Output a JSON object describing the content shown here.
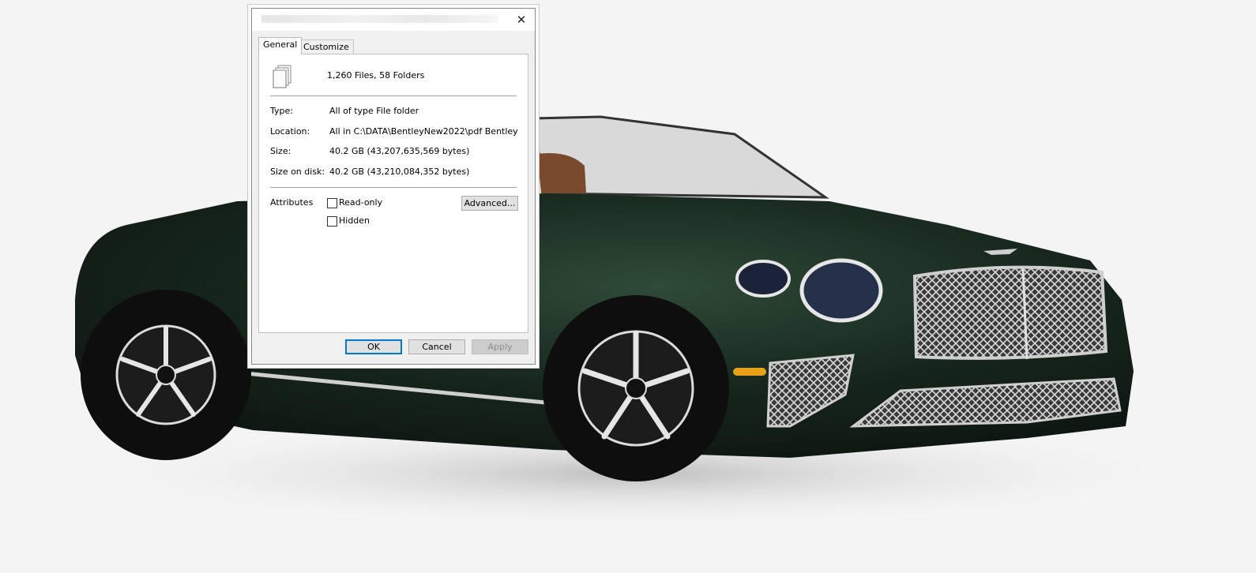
{
  "dialog": {
    "close_glyph": "✕",
    "tabs": [
      {
        "label": "General",
        "active": true
      },
      {
        "label": "Customize",
        "active": false
      }
    ],
    "summary": "1,260 Files, 58 Folders",
    "icon": "documents-icon",
    "fields": {
      "type": {
        "label": "Type:",
        "value": "All of type File folder"
      },
      "location": {
        "label": "Location:",
        "value": "All in C:\\DATA\\BentleyNew2022\\pdf Bentley"
      },
      "size": {
        "label": "Size:",
        "value": "40.2 GB (43,207,635,569 bytes)"
      },
      "size_on_disk": {
        "label": "Size on disk:",
        "value": "40.2 GB (43,210,084,352 bytes)"
      }
    },
    "attributes": {
      "label": "Attributes",
      "read_only": {
        "label": "Read-only",
        "checked": false
      },
      "hidden": {
        "label": "Hidden",
        "checked": false
      },
      "advanced_label": "Advanced..."
    },
    "buttons": {
      "ok": "OK",
      "cancel": "Cancel",
      "apply": "Apply"
    }
  },
  "background": {
    "subject": "dark green convertible car image",
    "colors": {
      "body": "#16261c",
      "backdrop": "#f4f4f4",
      "accent_blue": "#0078d7"
    }
  }
}
